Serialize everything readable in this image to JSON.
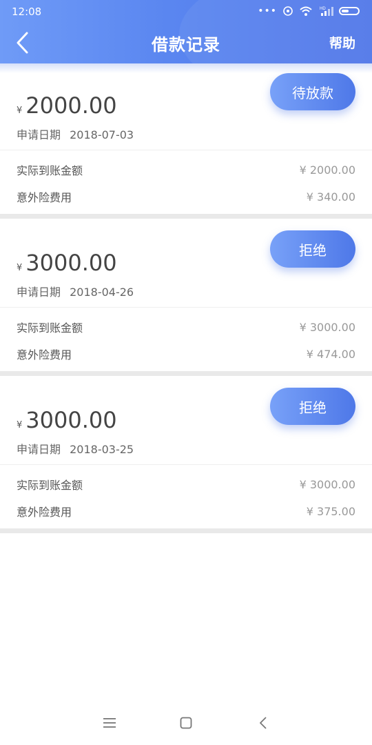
{
  "status_bar": {
    "time": "12:08",
    "icons": [
      "dots-icon",
      "alarm-icon",
      "wifi-icon",
      "signal-icon",
      "battery-icon"
    ],
    "hd_label": "HD"
  },
  "header": {
    "title": "借款记录",
    "help_label": "帮助",
    "back_icon": "chevron-left-icon"
  },
  "records": [
    {
      "currency": "¥",
      "amount": "2000.00",
      "status": "待放款",
      "date_label": "申请日期",
      "date": "2018-07-03",
      "received_label": "实际到账金额",
      "received_value": "¥ 2000.00",
      "insurance_label": "意外险费用",
      "insurance_value": "¥ 340.00"
    },
    {
      "currency": "¥",
      "amount": "3000.00",
      "status": "拒绝",
      "date_label": "申请日期",
      "date": "2018-04-26",
      "received_label": "实际到账金额",
      "received_value": "¥ 3000.00",
      "insurance_label": "意外险费用",
      "insurance_value": "¥ 474.00"
    },
    {
      "currency": "¥",
      "amount": "3000.00",
      "status": "拒绝",
      "date_label": "申请日期",
      "date": "2018-03-25",
      "received_label": "实际到账金额",
      "received_value": "¥ 3000.00",
      "insurance_label": "意外险费用",
      "insurance_value": "¥ 375.00"
    }
  ],
  "colors": {
    "header_start": "#6f9bf7",
    "header_end": "#4f76e8",
    "button_start": "#78a1f8",
    "button_end": "#4e78e8",
    "separator": "#e9e9e9"
  },
  "bottom_nav": {
    "icons": [
      "menu-icon",
      "home-square-icon",
      "back-arrow-icon"
    ]
  }
}
